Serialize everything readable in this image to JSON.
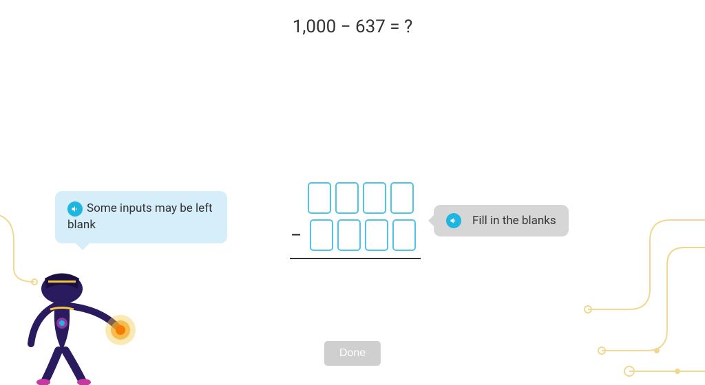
{
  "question": {
    "text": "1,000 − 637 = ?"
  },
  "tooltips": {
    "left": "Some inputs may be left blank",
    "right": "Fill in the blanks"
  },
  "operator": "–",
  "button": {
    "done": "Done"
  },
  "inputs": {
    "row1": [
      "",
      "",
      "",
      ""
    ],
    "row2": [
      "",
      "",
      "",
      ""
    ]
  }
}
